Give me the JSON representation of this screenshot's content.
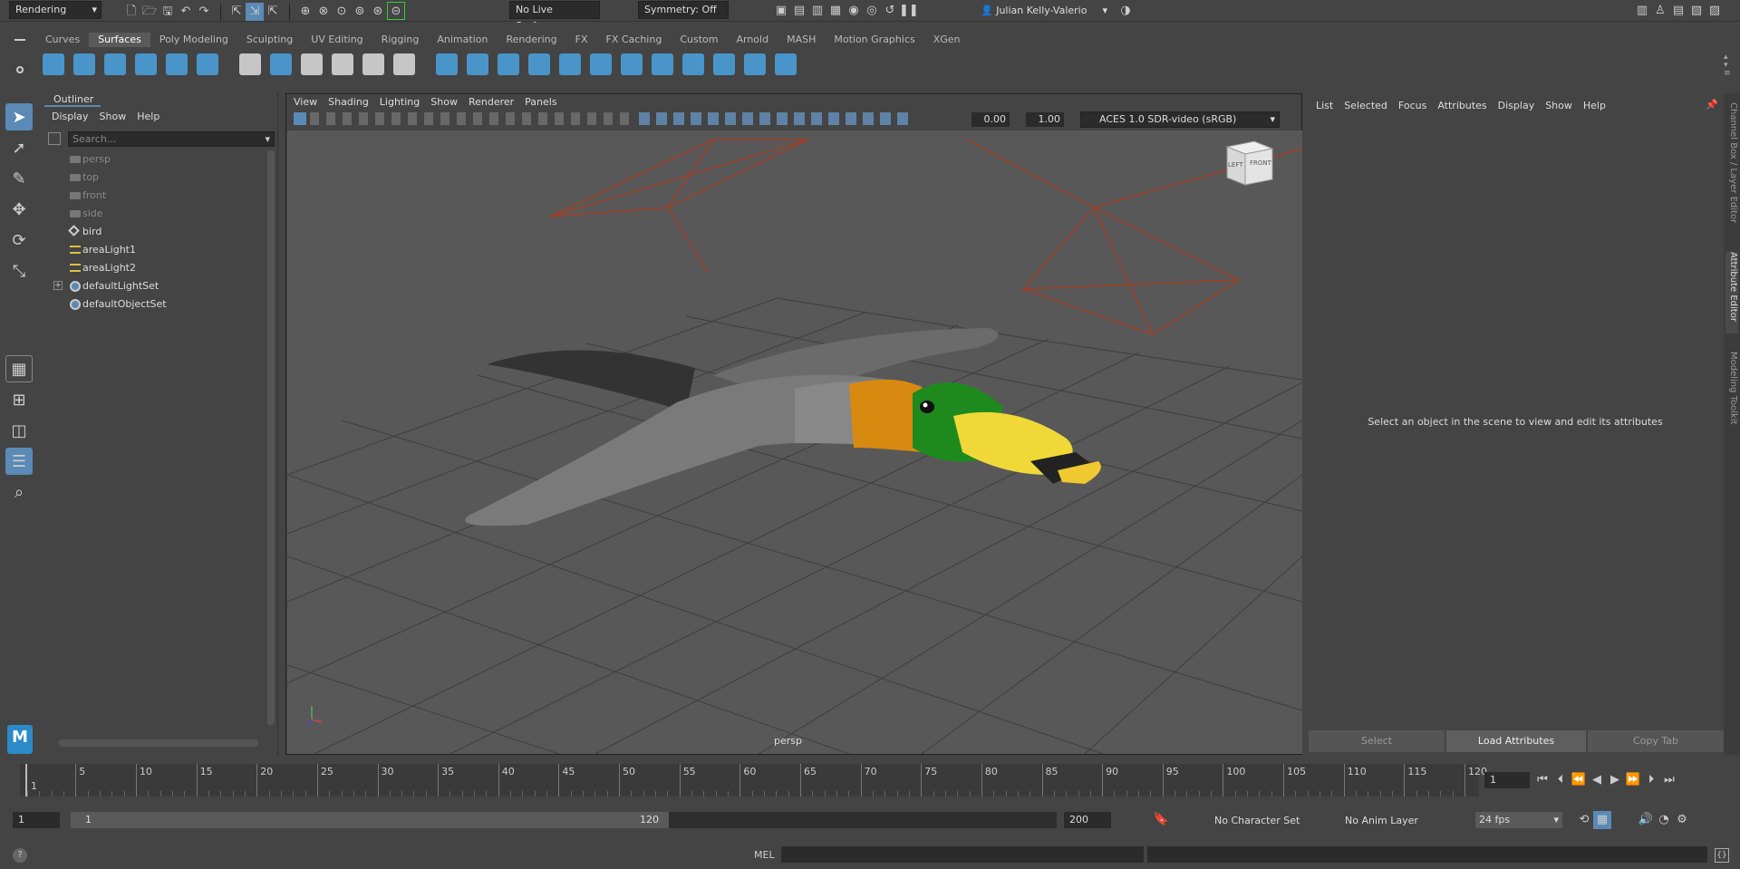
{
  "status_line": {
    "menu_set": "Rendering",
    "live_surface": "No Live Surface",
    "symmetry": "Symmetry: Off",
    "user": "Julian Kelly-Valerio"
  },
  "shelf": {
    "tabs": [
      "Curves",
      "Surfaces",
      "Poly Modeling",
      "Sculpting",
      "UV Editing",
      "Rigging",
      "Animation",
      "Rendering",
      "FX",
      "FX Caching",
      "Custom",
      "Arnold",
      "MASH",
      "Motion Graphics",
      "XGen"
    ],
    "active_tab": "Surfaces",
    "icon_colors": [
      "#4aa3e0",
      "#4aa3e0",
      "#4aa3e0",
      "#4aa3e0",
      "#4aa3e0",
      "#4aa3e0",
      "#ddd",
      "#4aa3e0",
      "#ddd",
      "#ddd",
      "#ddd",
      "#ddd",
      "#4aa3e0",
      "#4aa3e0",
      "#4aa3e0",
      "#4aa3e0",
      "#4aa3e0",
      "#4aa3e0",
      "#4aa3e0",
      "#4aa3e0",
      "#4aa3e0",
      "#4aa3e0",
      "#4aa3e0",
      "#4aa3e0"
    ]
  },
  "outliner": {
    "title": "Outliner",
    "menu": [
      "Display",
      "Show",
      "Help"
    ],
    "search_placeholder": "Search...",
    "items": [
      {
        "label": "persp",
        "icon": "camera-icon",
        "dim": true
      },
      {
        "label": "top",
        "icon": "camera-icon",
        "dim": true
      },
      {
        "label": "front",
        "icon": "camera-icon",
        "dim": true
      },
      {
        "label": "side",
        "icon": "camera-icon",
        "dim": true
      },
      {
        "label": "bird",
        "icon": "mesh-icon",
        "dim": false
      },
      {
        "label": "areaLight1",
        "icon": "area-light-icon",
        "dim": false
      },
      {
        "label": "areaLight2",
        "icon": "area-light-icon",
        "dim": false
      },
      {
        "label": "defaultLightSet",
        "icon": "set-icon",
        "dim": false,
        "expandable": true
      },
      {
        "label": "defaultObjectSet",
        "icon": "set-icon",
        "dim": false
      }
    ]
  },
  "viewport": {
    "menu": [
      "View",
      "Shading",
      "Lighting",
      "Show",
      "Renderer",
      "Panels"
    ],
    "exposure": "0.00",
    "gamma": "1.00",
    "color_space": "ACES 1.0 SDR-video (sRGB)",
    "camera_label": "persp",
    "view_cube_left": "LEFT",
    "view_cube_front": "FRONT"
  },
  "attribute_editor": {
    "menu": [
      "List",
      "Selected",
      "Focus",
      "Attributes",
      "Display",
      "Show",
      "Help"
    ],
    "message": "Select an object in the scene to view and edit its attributes",
    "buttons": [
      "Select",
      "Load Attributes",
      "Copy Tab"
    ],
    "side_tabs": [
      "Channel Box / Layer Editor",
      "Attribute Editor",
      "Modeling Toolkit"
    ]
  },
  "time_slider": {
    "tick_labels": [
      "1",
      "5",
      "10",
      "15",
      "20",
      "25",
      "30",
      "35",
      "40",
      "45",
      "50",
      "55",
      "60",
      "65",
      "70",
      "75",
      "80",
      "85",
      "90",
      "95",
      "100",
      "105",
      "110",
      "115",
      "120"
    ],
    "current_frame": "1"
  },
  "range_slider": {
    "start": "1",
    "range_start": "1",
    "range_end": "120",
    "end": "200",
    "character_set": "No Character Set",
    "anim_layer": "No Anim Layer",
    "fps": "24 fps"
  },
  "command_line": {
    "lang": "MEL",
    "help_icon": "help-icon"
  }
}
